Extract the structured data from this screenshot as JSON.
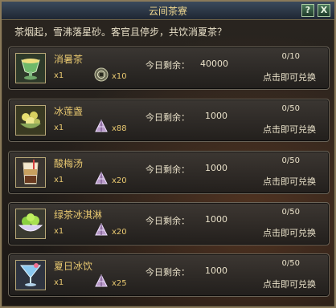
{
  "window": {
    "title": "云间茶寮",
    "help_label": "?",
    "close_label": "X",
    "subtitle": "茶烟起，雪沸落星砂。客官且停步，共饮消夏茶？"
  },
  "remaining_label": "今日剩余：",
  "exchange_label": "点击即可兑换",
  "items": [
    {
      "name": "消暑茶",
      "qty": "x1",
      "cost_icon": "coin-icon",
      "cost": "x10",
      "remaining": "40000",
      "exchanged": "0/10"
    },
    {
      "name": "冰莲盏",
      "qty": "x1",
      "cost_icon": "crystal-icon",
      "cost": "x88",
      "remaining": "1000",
      "exchanged": "0/50"
    },
    {
      "name": "酸梅汤",
      "qty": "x1",
      "cost_icon": "crystal-icon",
      "cost": "x20",
      "remaining": "1000",
      "exchanged": "0/50"
    },
    {
      "name": "绿茶冰淇淋",
      "qty": "x1",
      "cost_icon": "crystal-icon",
      "cost": "x20",
      "remaining": "1000",
      "exchanged": "0/50"
    },
    {
      "name": "夏日冰饮",
      "qty": "x1",
      "cost_icon": "crystal-icon",
      "cost": "x25",
      "remaining": "1000",
      "exchanged": "0/50"
    }
  ],
  "colors": {
    "gold_text": "#e8c870",
    "title_text": "#f0d890",
    "body_text": "#e8e0c8",
    "border": "#8a7a5a"
  }
}
